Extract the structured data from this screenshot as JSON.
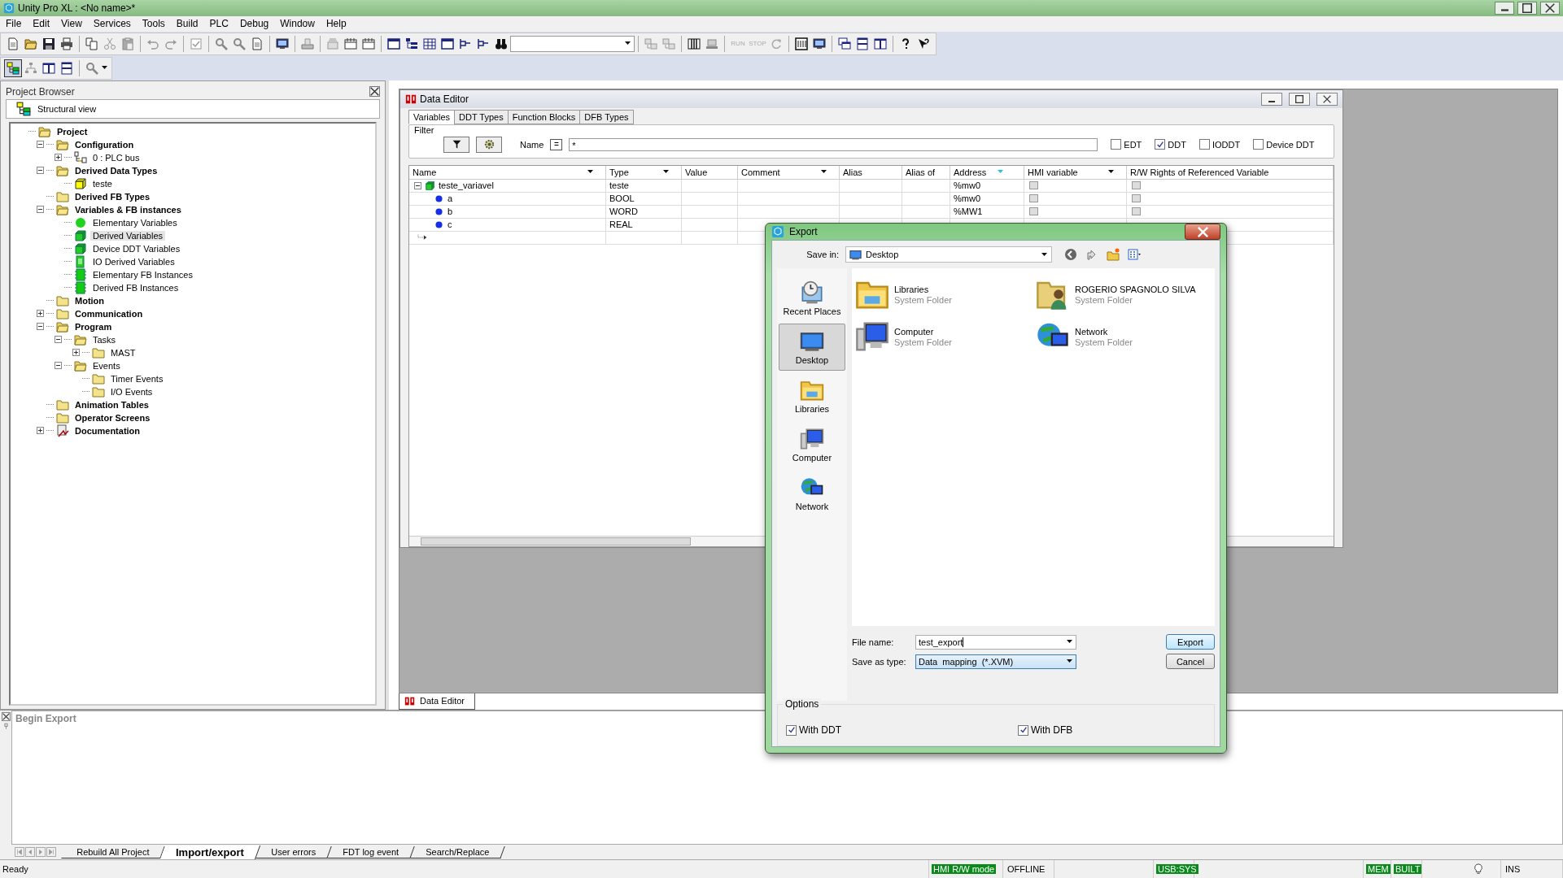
{
  "window": {
    "title": "Unity Pro XL : <No name>*"
  },
  "menu": [
    "File",
    "Edit",
    "View",
    "Services",
    "Tools",
    "Build",
    "PLC",
    "Debug",
    "Window",
    "Help"
  ],
  "plc_buttons": [
    {
      "label": "RUN",
      "disabled": true
    },
    {
      "label": "STOP",
      "disabled": true
    }
  ],
  "project_browser": {
    "title": "Project Browser",
    "view": "Structural view",
    "tree": [
      {
        "label": "Project",
        "kind": "folder_open",
        "selected": false,
        "children": [
          {
            "label": "Configuration",
            "kind": "folder_open",
            "expanded": true,
            "selected": false,
            "children": [
              {
                "label": "0 : PLC bus",
                "kind": "bus",
                "expanded": false,
                "selected": false
              }
            ]
          },
          {
            "label": "Derived Data Types",
            "kind": "folder_open",
            "expanded": true,
            "selected": false,
            "children": [
              {
                "label": "teste",
                "kind": "cube",
                "selected": false
              }
            ]
          },
          {
            "label": "Derived FB Types",
            "kind": "folder",
            "selected": false
          },
          {
            "label": "Variables & FB instances",
            "kind": "folder_open",
            "expanded": true,
            "selected": false,
            "children": [
              {
                "label": "Elementary Variables",
                "kind": "dot",
                "selected": false
              },
              {
                "label": "Derived Variables",
                "kind": "green_cube",
                "selected": true
              },
              {
                "label": "Device DDT Variables",
                "kind": "green_cube",
                "selected": false
              },
              {
                "label": "IO Derived Variables",
                "kind": "io",
                "selected": false
              },
              {
                "label": "Elementary FB Instances",
                "kind": "fb",
                "selected": false
              },
              {
                "label": "Derived FB Instances",
                "kind": "fb",
                "selected": false
              }
            ]
          },
          {
            "label": "Motion",
            "kind": "folder",
            "selected": false
          },
          {
            "label": "Communication",
            "kind": "folder",
            "expanded": false,
            "selected": false
          },
          {
            "label": "Program",
            "kind": "folder_open",
            "expanded": true,
            "selected": false,
            "children": [
              {
                "label": "Tasks",
                "kind": "folder_open",
                "expanded": true,
                "selected": false,
                "children": [
                  {
                    "label": "MAST",
                    "kind": "folder",
                    "expanded": false,
                    "selected": false
                  }
                ]
              },
              {
                "label": "Events",
                "kind": "folder_open",
                "expanded": true,
                "selected": false,
                "children": [
                  {
                    "label": "Timer Events",
                    "kind": "folder",
                    "selected": false
                  },
                  {
                    "label": "I/O Events",
                    "kind": "folder",
                    "selected": false
                  }
                ]
              }
            ]
          },
          {
            "label": "Animation Tables",
            "kind": "folder",
            "selected": false
          },
          {
            "label": "Operator Screens",
            "kind": "folder",
            "selected": false
          },
          {
            "label": "Documentation",
            "kind": "doc",
            "expanded": false,
            "selected": false
          }
        ]
      }
    ]
  },
  "data_editor": {
    "title": "Data Editor",
    "tabs": [
      {
        "label": "Variables",
        "selected": true
      },
      {
        "label": "DDT Types",
        "selected": false
      },
      {
        "label": "Function Blocks",
        "selected": false
      },
      {
        "label": "DFB Types",
        "selected": false
      }
    ],
    "filter_label": "Filter",
    "name_label": "Name",
    "name_operator": "=",
    "name_value": "*",
    "type_filters": [
      {
        "label": "EDT",
        "checked": false
      },
      {
        "label": "DDT",
        "checked": true
      },
      {
        "label": "IODDT",
        "checked": false
      },
      {
        "label": "Device DDT",
        "checked": false
      }
    ],
    "columns": [
      {
        "label": "Name",
        "dropdown": true,
        "filtered": false
      },
      {
        "label": "Type",
        "dropdown": true,
        "filtered": false
      },
      {
        "label": "Value",
        "dropdown": false,
        "filtered": false
      },
      {
        "label": "Comment",
        "dropdown": true,
        "filtered": false
      },
      {
        "label": "Alias",
        "dropdown": false,
        "filtered": false
      },
      {
        "label": "Alias of",
        "dropdown": false,
        "filtered": false
      },
      {
        "label": "Address",
        "dropdown": false,
        "filtered": true
      },
      {
        "label": "HMI variable",
        "dropdown": true,
        "filtered": false
      },
      {
        "label": "R/W Rights of Referenced Variable",
        "dropdown": false,
        "filtered": false
      }
    ],
    "rows": [
      {
        "kind": "struct",
        "expanded": true,
        "name": "teste_variavel",
        "type": "teste",
        "address": "%mw0",
        "hmi": false,
        "rw": false
      },
      {
        "kind": "elementary",
        "name": "a",
        "type": "BOOL",
        "address": "%mw0",
        "hmi": false,
        "rw": false
      },
      {
        "kind": "elementary",
        "name": "b",
        "type": "WORD",
        "address": "%MW1",
        "hmi": false,
        "rw": false
      },
      {
        "kind": "elementary",
        "name": "c",
        "type": "REAL"
      }
    ]
  },
  "mdi_tabs": [
    {
      "label": "Data Editor",
      "selected": true
    }
  ],
  "export_dialog": {
    "title": "Export",
    "save_in_label": "Save in:",
    "save_in": "Desktop",
    "places": [
      {
        "label": "Recent Places",
        "kind": "recent",
        "selected": false
      },
      {
        "label": "Desktop",
        "kind": "desktop",
        "selected": true
      },
      {
        "label": "Libraries",
        "kind": "libraries",
        "selected": false
      },
      {
        "label": "Computer",
        "kind": "computer",
        "selected": false
      },
      {
        "label": "Network",
        "kind": "network",
        "selected": false
      }
    ],
    "items": [
      {
        "name": "Libraries",
        "subtitle": "System Folder",
        "kind": "libraries"
      },
      {
        "name": "ROGERIO SPAGNOLO SILVA",
        "subtitle": "System Folder",
        "kind": "user"
      },
      {
        "name": "Computer",
        "subtitle": "System Folder",
        "kind": "computer"
      },
      {
        "name": "Network",
        "subtitle": "System Folder",
        "kind": "network"
      }
    ],
    "file_name_label": "File name:",
    "file_name": "test_export",
    "save_type_label": "Save as type:",
    "save_type": "Data  mapping  (*.XVM)",
    "buttons": [
      {
        "label": "Export",
        "default": true
      },
      {
        "label": "Cancel",
        "default": false
      }
    ],
    "options_title": "Options",
    "options": [
      {
        "label": "With DDT",
        "checked": true
      },
      {
        "label": "With DFB",
        "checked": true
      }
    ]
  },
  "output": {
    "lines": [
      "Begin Export"
    ],
    "tabs": [
      {
        "label": "Rebuild All Project",
        "selected": false
      },
      {
        "label": "Import/export",
        "selected": true
      },
      {
        "label": "User errors",
        "selected": false
      },
      {
        "label": "FDT log event",
        "selected": false
      },
      {
        "label": "Search/Replace",
        "selected": false
      }
    ]
  },
  "status_bar": {
    "text": "Ready",
    "fields": [
      {
        "label": "HMI R/W mode",
        "highlight": true
      },
      {
        "label": "OFFLINE",
        "highlight": false
      },
      {
        "label": "USB:SYS",
        "highlight": true
      },
      {
        "label": "MEM",
        "highlight": true
      },
      {
        "label": "BUILT",
        "highlight": true
      },
      {
        "label": "INS",
        "highlight": false
      }
    ]
  }
}
